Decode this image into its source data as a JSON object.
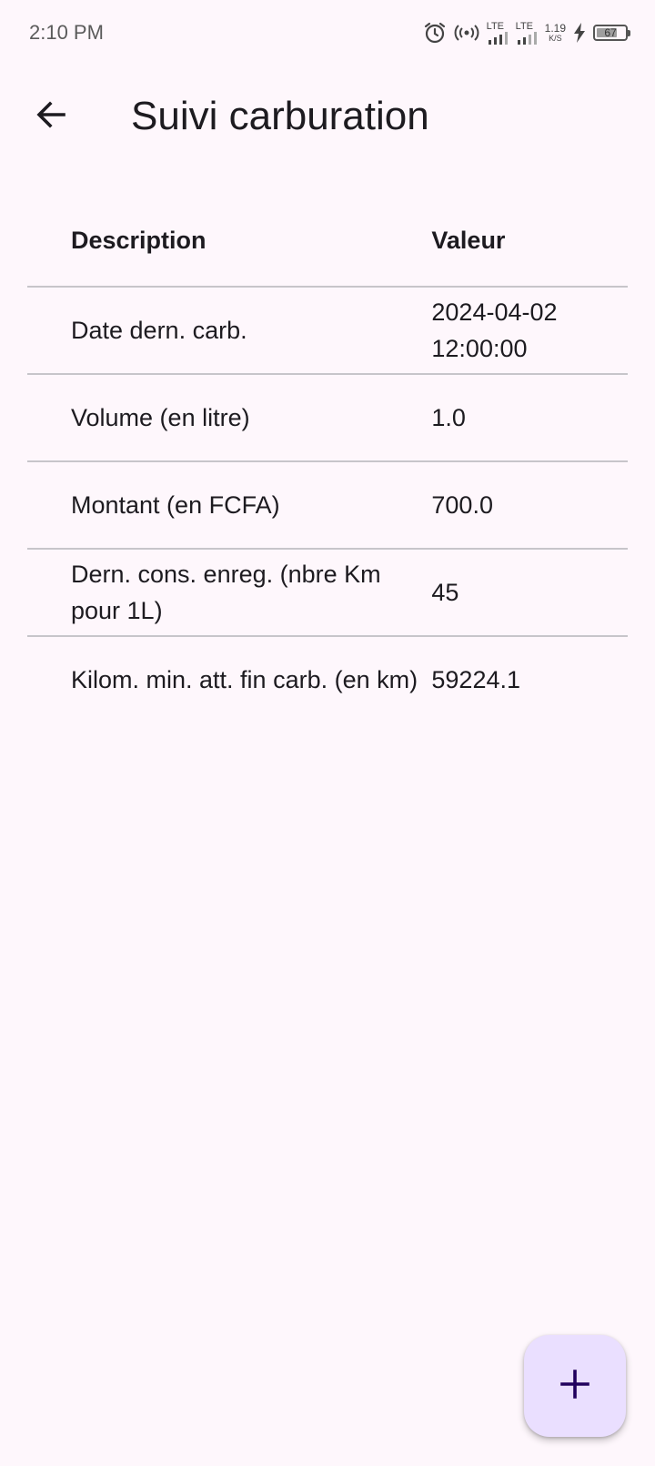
{
  "status_bar": {
    "time": "2:10 PM",
    "sim1_label": "LTE",
    "sim2_label": "LTE",
    "net_speed_value": "1.19",
    "net_speed_unit": "K/S",
    "battery_level": "67",
    "icons": [
      "alarm-icon",
      "hotspot-icon",
      "signal-icon",
      "signal-icon",
      "charging-icon",
      "battery-icon"
    ]
  },
  "app_bar": {
    "title": "Suivi carburation",
    "back_icon": "arrow-back-icon"
  },
  "table": {
    "headers": {
      "description": "Description",
      "value": "Valeur"
    },
    "rows": [
      {
        "description": "Date dern. carb.",
        "value": "2024-04-02 12:00:00"
      },
      {
        "description": "Volume (en litre)",
        "value": "1.0"
      },
      {
        "description": "Montant (en FCFA)",
        "value": "700.0"
      },
      {
        "description": "Dern. cons. enreg. (nbre Km pour 1L)",
        "value": "45"
      },
      {
        "description": "Kilom. min. att. fin carb. (en km)",
        "value": "59224.1"
      }
    ]
  },
  "fab": {
    "icon": "add-icon"
  },
  "colors": {
    "background": "#fef7fc",
    "fab_background": "#eadfff",
    "fab_icon": "#21005d",
    "divider": "#c7c5ca"
  }
}
